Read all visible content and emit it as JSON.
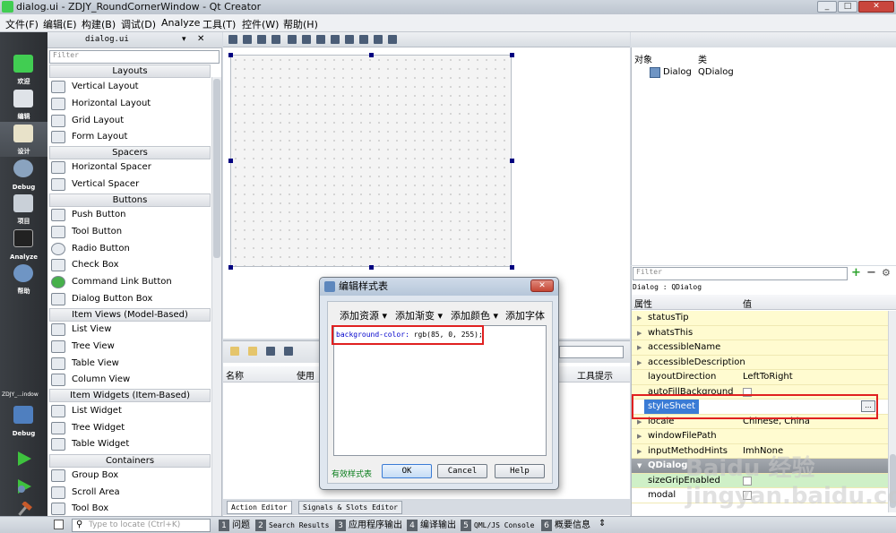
{
  "window": {
    "title": "dialog.ui - ZDJY_RoundCornerWindow - Qt Creator",
    "controls": [
      "_",
      "□",
      "✕"
    ]
  },
  "menu": [
    "文件(F)",
    "编辑(E)",
    "构建(B)",
    "调试(D)",
    "Analyze",
    "工具(T)",
    "控件(W)",
    "帮助(H)"
  ],
  "modes": [
    {
      "label": "欢迎"
    },
    {
      "label": "编辑"
    },
    {
      "label": "设计"
    },
    {
      "label": "Debug"
    },
    {
      "label": "项目"
    },
    {
      "label": "Analyze"
    },
    {
      "label": "帮助"
    }
  ],
  "kit": {
    "name": "ZDJY_...indow",
    "label": "Debug"
  },
  "widgetbox": {
    "file_tab": "dialog.ui",
    "filter": "Filter",
    "categories": {
      "layouts": "Layouts",
      "spacers": "Spacers",
      "buttons": "Buttons",
      "item_views": "Item Views (Model-Based)",
      "item_widgets": "Item Widgets (Item-Based)",
      "containers": "Containers"
    },
    "layouts": [
      "Vertical Layout",
      "Horizontal Layout",
      "Grid Layout",
      "Form Layout"
    ],
    "spacers": [
      "Horizontal Spacer",
      "Vertical Spacer"
    ],
    "buttons": [
      "Push Button",
      "Tool Button",
      "Radio Button",
      "Check Box",
      "Command Link Button",
      "Dialog Button Box"
    ],
    "item_views": [
      "List View",
      "Tree View",
      "Table View",
      "Column View"
    ],
    "item_widgets": [
      "List Widget",
      "Tree Widget",
      "Table Widget"
    ],
    "containers": [
      "Group Box",
      "Scroll Area",
      "Tool Box"
    ]
  },
  "bottom_pane": {
    "col_name": "名称",
    "col_use": "使用",
    "col_tooltip": "工具提示",
    "tabs": [
      "Action Editor",
      "Signals & Slots Editor"
    ]
  },
  "object_inspector": {
    "col_object": "对象",
    "col_class": "类",
    "rows": [
      {
        "object": "Dialog",
        "class": "QDialog"
      }
    ]
  },
  "property_editor": {
    "filter": "Filter",
    "class_line": "Dialog : QDialog",
    "col_prop": "属性",
    "col_value": "值",
    "rows": [
      {
        "name": "statusTip",
        "value": ""
      },
      {
        "name": "whatsThis",
        "value": ""
      },
      {
        "name": "accessibleName",
        "value": ""
      },
      {
        "name": "accessibleDescription",
        "value": ""
      },
      {
        "name": "layoutDirection",
        "value": "LeftToRight"
      },
      {
        "name": "autoFillBackground",
        "value": ""
      },
      {
        "name": "styleSheet",
        "value": ""
      },
      {
        "name": "locale",
        "value": "Chinese, China"
      },
      {
        "name": "windowFilePath",
        "value": ""
      },
      {
        "name": "inputMethodHints",
        "value": "ImhNone"
      }
    ],
    "group": "QDialog",
    "group_rows": [
      {
        "name": "sizeGripEnabled",
        "value": ""
      },
      {
        "name": "modal",
        "value": ""
      }
    ],
    "ellipsis": "..."
  },
  "dialog": {
    "title": "编辑样式表",
    "tools": [
      "添加资源",
      "添加渐变",
      "添加颜色",
      "添加字体"
    ],
    "css_key": "background-color:",
    "css_val": " rgb(85, 0, 255);",
    "valid": "有效样式表",
    "ok": "OK",
    "cancel": "Cancel",
    "help": "Help"
  },
  "statusbar": {
    "locator": "Type to locate (Ctrl+K)",
    "panes": [
      {
        "n": "1",
        "label": "问题"
      },
      {
        "n": "2",
        "label": "Search Results"
      },
      {
        "n": "3",
        "label": "应用程序输出"
      },
      {
        "n": "4",
        "label": "编译输出"
      },
      {
        "n": "5",
        "label": "QML/JS Console"
      },
      {
        "n": "6",
        "label": "概要信息"
      }
    ]
  },
  "watermark": "Baidu 经验 jingyan.baidu.com"
}
